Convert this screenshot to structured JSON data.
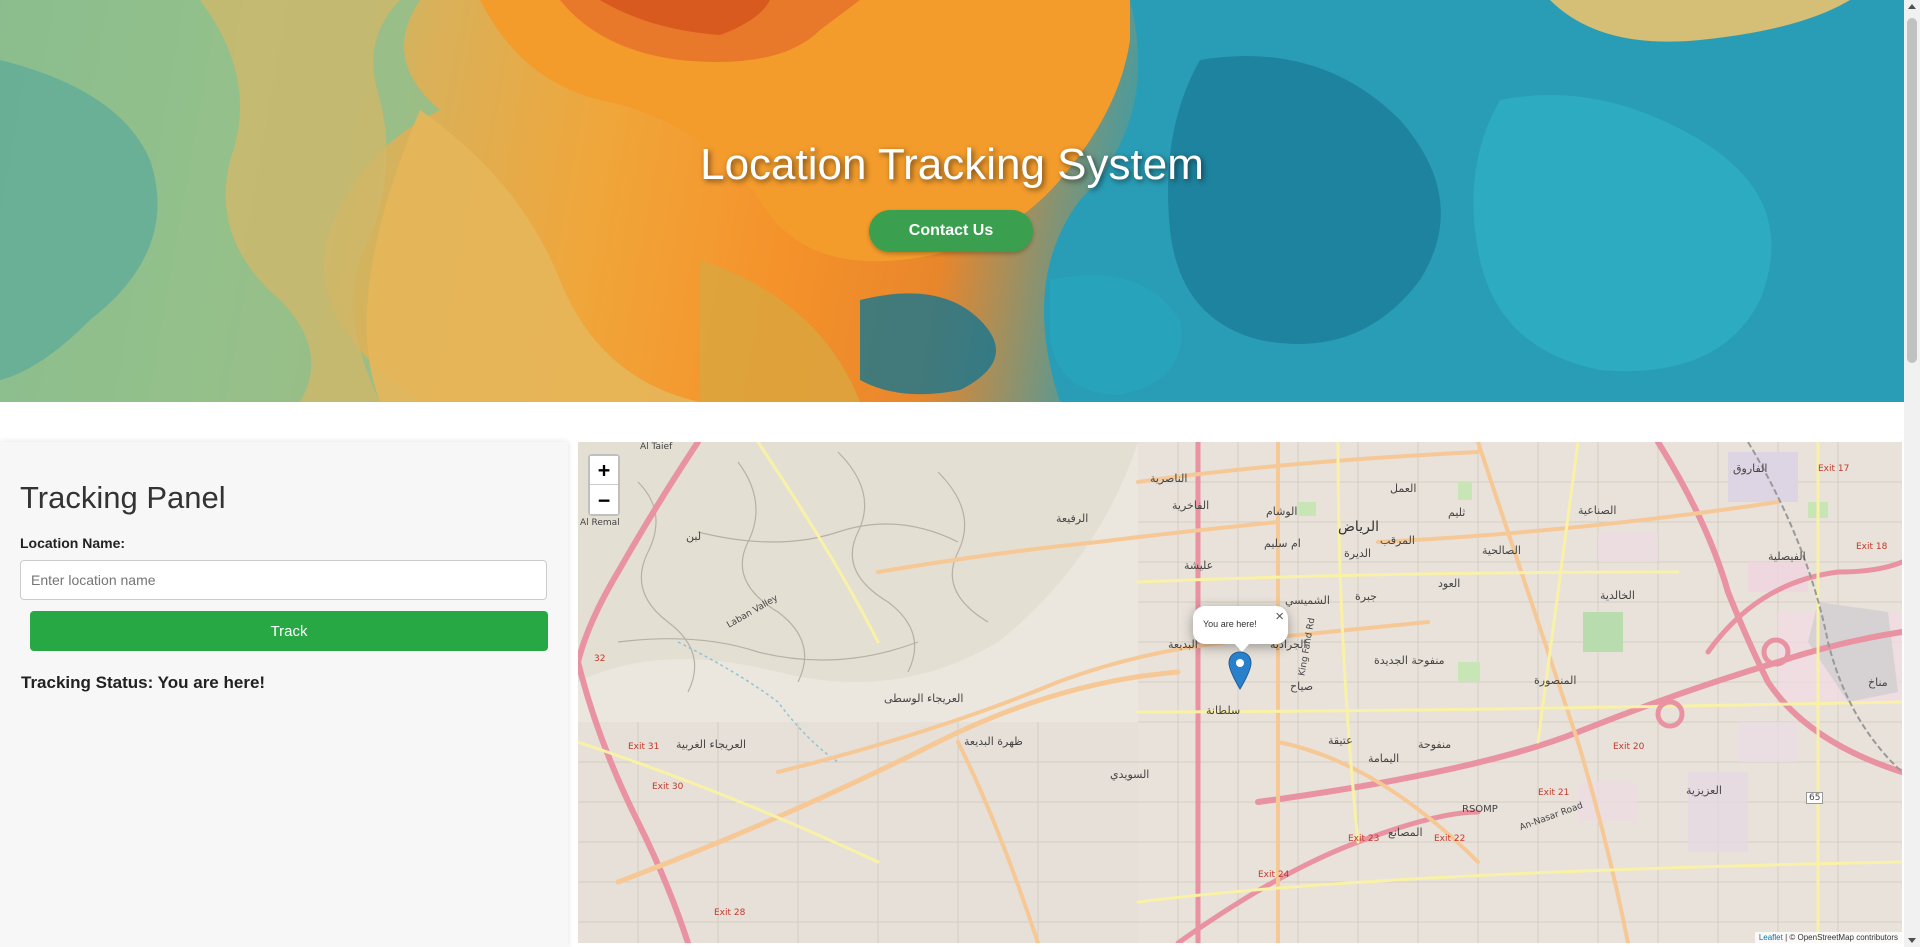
{
  "hero": {
    "title": "Location Tracking System",
    "contact_label": "Contact Us"
  },
  "panel": {
    "title": "Tracking Panel",
    "location_label": "Location Name:",
    "location_placeholder": "Enter location name",
    "location_value": "",
    "track_label": "Track",
    "status_text": "Tracking Status: You are here!"
  },
  "map": {
    "zoom_in": "+",
    "zoom_out": "−",
    "popup_text": "You are here!",
    "popup_close": "×",
    "attribution_link": "Leaflet",
    "attribution_text": " | © OpenStreetMap contributors",
    "labels": {
      "riyadh": "الرياض",
      "naseriah": "الناصرية",
      "fakhriah": "الفاخرية",
      "rafiah": "الرفيعة",
      "washam": "الوشام",
      "amal": "العمل",
      "thulaim": "ثليم",
      "sinaiyah": "الصناعية",
      "murabba": "المرقب",
      "salihiyah": "الصالحية",
      "umm_sulaim": "ام سليم",
      "dirah": "الديرة",
      "ulaishah": "عليشة",
      "shumaisi": "الشميسي",
      "jabrah": "جبرة",
      "oud": "العود",
      "khalidiyah": "الخالدية",
      "faisaliyah": "الفيصلية",
      "faruq": "الفاروق",
      "badiah": "البديعة",
      "jarradiyah": "الجرادية",
      "manfuhah_jadidah": "منفوحة الجديدة",
      "mansurah": "المنصورة",
      "siyah": "صياح",
      "sultanah": "سلطانة",
      "uraija_wusta": "العريجاء الوسطى",
      "dhahrat_badiah": "ظهرة البديعة",
      "uraija_gharbiyah": "العريجاء الغربية",
      "suwaidi": "السويدي",
      "utaiqah": "عتيقة",
      "yamamah": "اليمامة",
      "manfuhah": "منفوحة",
      "aziziyah": "العزيزية",
      "masani": "المصانع",
      "laban": "لبن",
      "manakh": "مناخ",
      "al_taief": "Al Taief",
      "al_remal": "Al Remal",
      "laban_valley": "Laban Valley",
      "king_fahd": "King Fahd Rd",
      "an_nasar": "An-Nasar Road",
      "rsomp": "RSOMP",
      "exit_17": "Exit 17",
      "exit_18": "Exit 18",
      "exit_20": "Exit 20",
      "exit_21": "Exit 21",
      "exit_22": "Exit 22",
      "exit_23": "Exit 23",
      "exit_24": "Exit 24",
      "exit_28": "Exit 28",
      "exit_30": "Exit 30",
      "exit_31": "Exit 31",
      "r65": "65",
      "r32": "32"
    }
  },
  "colors": {
    "contact_button": "#3aa050",
    "track_button": "#28a745",
    "panel_bg": "#f7f7f7",
    "marker": "#2a81cb"
  }
}
